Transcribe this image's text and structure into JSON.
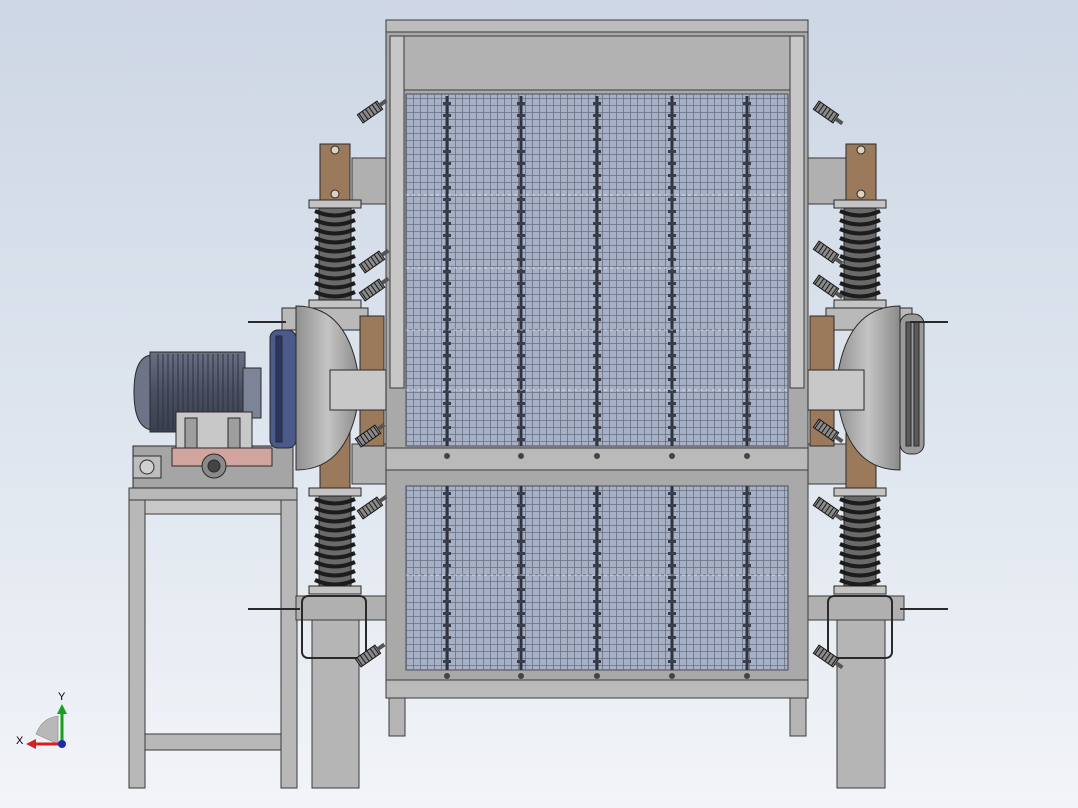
{
  "viewport": {
    "background_top": "#cdd6e4",
    "background_bottom": "#f2f4f8"
  },
  "colors": {
    "steel": "#a9a9a9",
    "steel_dark": "#7d7d7d",
    "edge": "#3a3a3a",
    "bracket": "#9b7a5c",
    "motor_blue": "#525a6e",
    "spring_dark": "#2a2a2a",
    "pulley_blue": "#4a5a8a",
    "screen_tint": "#a7b1c6"
  },
  "triad": {
    "x_label": "X",
    "y_label": "Y",
    "x_color": "#d42020",
    "y_color": "#18a018",
    "z_color": "#1c2ab0"
  }
}
